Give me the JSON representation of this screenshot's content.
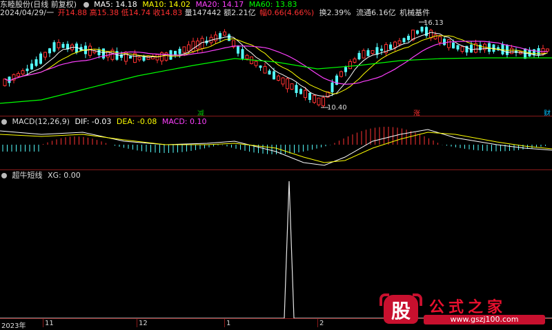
{
  "app": {
    "title": "东睦股份(日线 前复权)"
  },
  "main_panel": {
    "ma_labels": [
      {
        "text": "MA5: 14.18",
        "color": "#ffffff"
      },
      {
        "text": "MA10: 14.02",
        "color": "#ffff00"
      },
      {
        "text": "MA20: 14.17",
        "color": "#ff40ff"
      },
      {
        "text": "MA60: 13.83",
        "color": "#00ff00"
      }
    ],
    "info": {
      "date": "2024/04/29/一",
      "open": "开14.88",
      "high": "高15.38",
      "low": "低14.74",
      "close": "收14.83",
      "volume": "量147442",
      "amount": "额2.21亿",
      "change": "幅0.66(4.66%)",
      "turnover": "换2.39%",
      "float_cap": "流通6.16亿",
      "industry": "机械基件"
    },
    "annotations": {
      "high": "16.13",
      "low": "10.40"
    },
    "signals": [
      {
        "text": "减",
        "color": "#00c000"
      },
      {
        "text": "涨",
        "color": "#ff3030"
      },
      {
        "text": "财",
        "color": "#00c0ff"
      }
    ]
  },
  "macd_panel": {
    "label": "MACD(12,26,9)",
    "dif": "DIF: -0.03",
    "dea": "DEA: -0.08",
    "macd": "MACD: 0.10"
  },
  "xg_panel": {
    "label": "超牛短线",
    "xg": "XG: 0.00"
  },
  "axis": {
    "year": "2023年",
    "months": [
      "11",
      "12",
      "1",
      "2"
    ]
  },
  "watermark": {
    "big_char": "股",
    "text": "公式之家",
    "url": "www.gszj100.com"
  }
}
